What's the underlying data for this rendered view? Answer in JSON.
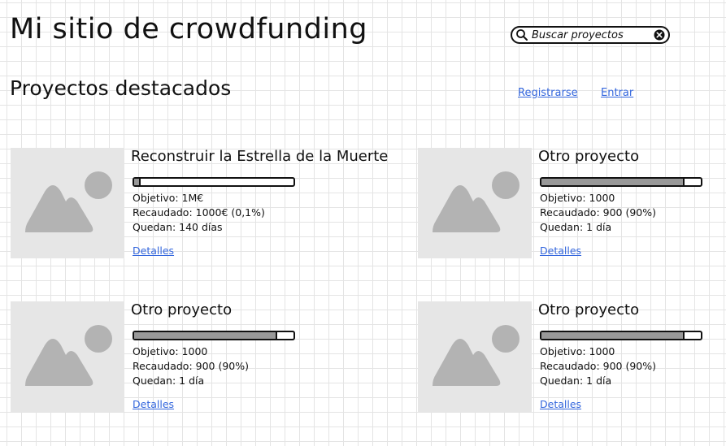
{
  "header": {
    "site_title": "Mi sitio de crowdfunding",
    "search": {
      "placeholder": "Buscar proyectos",
      "value": ""
    }
  },
  "nav": {
    "register_label": "Registrarse",
    "login_label": "Entrar"
  },
  "section_title": "Proyectos destacados",
  "projects": [
    {
      "title": "Reconstruir la Estrella de la Muerte",
      "progress": 0.001,
      "objetivo": "Objetivo: 1M€",
      "recaudado": "Recaudado: 1000€ (0,1%)",
      "quedan": "Quedan: 140 días",
      "details_label": "Detalles"
    },
    {
      "title": "Otro proyecto",
      "progress": 0.9,
      "objetivo": "Objetivo: 1000",
      "recaudado": "Recaudado: 900 (90%)",
      "quedan": "Quedan: 1 día",
      "details_label": "Detalles"
    },
    {
      "title": "Otro proyecto",
      "progress": 0.9,
      "objetivo": "Objetivo: 1000",
      "recaudado": "Recaudado: 900 (90%)",
      "quedan": "Quedan: 1 día",
      "details_label": "Detalles"
    },
    {
      "title": "Otro proyecto",
      "progress": 0.9,
      "objetivo": "Objetivo: 1000",
      "recaudado": "Recaudado: 900 (90%)",
      "quedan": "Quedan: 1 día",
      "details_label": "Detalles"
    }
  ],
  "icons": {
    "search": "magnifier-icon",
    "clear": "clear-icon",
    "image_placeholder": "image-placeholder-icon"
  },
  "colors": {
    "link": "#3366dd",
    "progress_fill": "#999999",
    "placeholder_bg": "#e6e6e6",
    "placeholder_shape": "#b3b3b3"
  }
}
